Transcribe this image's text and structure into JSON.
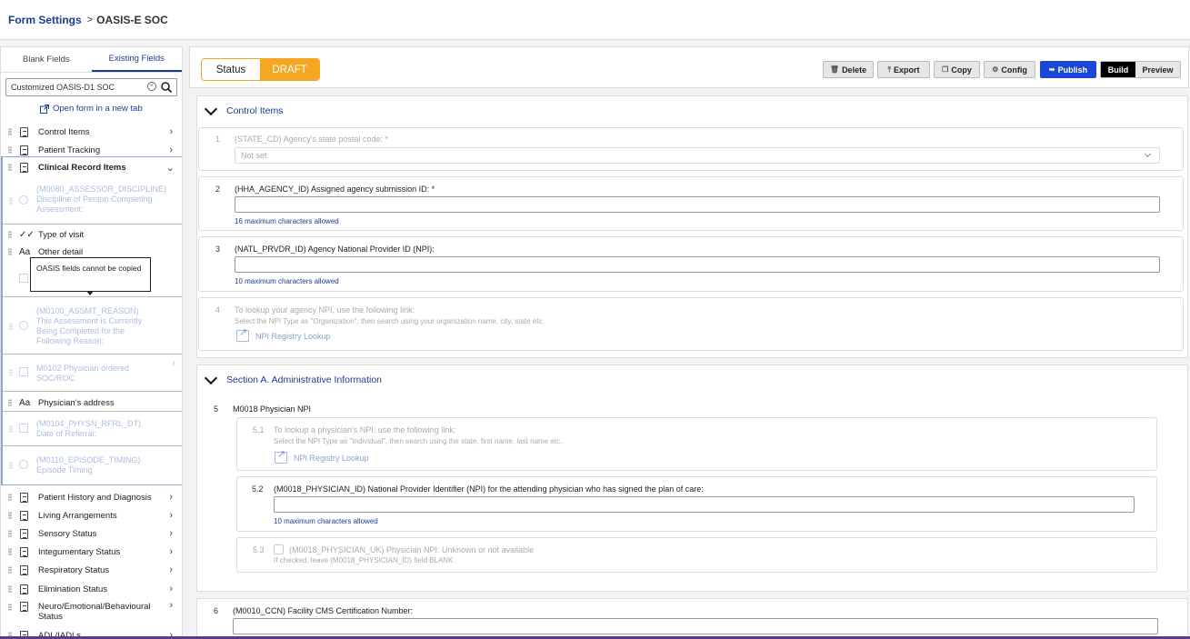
{
  "breadcrumb": {
    "parent": "Form Settings",
    "separator": ">",
    "current": "OASIS-E SOC"
  },
  "sidebar": {
    "tabs": [
      "Blank Fields",
      "Existing Fields"
    ],
    "search_value": "Customized OASIS-D1 SOC",
    "open_tab_label": "Open form in a new tab",
    "items_top": [
      "Control Items",
      "Patient Tracking",
      "Clinical Record Items"
    ],
    "sub_items": {
      "m0080": [
        "(M0080_ASSESSOR_DISCIPLINE)",
        "Discipline of Person Completing",
        "Assessment:"
      ],
      "type_of_visit": "Type of visit",
      "other_detail": "Other detail",
      "m0100": [
        "(M0100_ASSMT_REASON)",
        "This Assessment is Currently",
        "Being Completed for the",
        "Following Reason:"
      ],
      "m0102": [
        "M0102 Physician ordered",
        "SOC/ROC"
      ],
      "physician_address": "Physician's address",
      "m0104": [
        "(M0104_PHYSN_RFRL_DT)",
        "Date of Referral:"
      ],
      "m0110": [
        "(M0110_EPISODE_TIMING)",
        "Episode Timing"
      ]
    },
    "items_bottom": [
      "Patient History and Diagnosis",
      "Living Arrangements",
      "Sensory Status",
      "Integumentary Status",
      "Respiratory Status",
      "Elimination Status",
      "Neuro/Emotional/Behavioural Status",
      "ADL/IADLs"
    ],
    "tooltip": "OASIS fields cannot be copied"
  },
  "toolbar": {
    "status_label": "Status",
    "status_value": "DRAFT",
    "buttons": [
      "Delete",
      "Export",
      "Copy",
      "Config",
      "Publish"
    ],
    "mode": [
      "Build",
      "Preview"
    ]
  },
  "sections": [
    {
      "title": "Control Items",
      "questions": [
        {
          "num": "1",
          "label": "(STATE_CD) Agency's state postal code: *",
          "select": "Not set"
        },
        {
          "num": "2",
          "label": "(HHA_AGENCY_ID) Assigned agency submission ID: *",
          "hint": "16 maximum characters allowed"
        },
        {
          "num": "3",
          "label": "(NATL_PRVDR_ID) Agency National Provider ID (NPI):",
          "hint": "10 maximum characters allowed"
        },
        {
          "num": "4",
          "label": "To lookup your agency NPI, use the following link:",
          "hint": "Select the NPI Type as \"Organization\", then search using your organization name, city, state etc.",
          "link": "NPI Registry Lookup"
        }
      ]
    },
    {
      "title": "Section A. Administrative Information",
      "q5": {
        "num": "5",
        "label": "M0018 Physician NPI"
      },
      "q5_1": {
        "num": "5.1",
        "label": "To lookup a physician's NPI, use the following link:",
        "hint": "Select the NPI Type as \"Individual\", then search using the state, first name, last name etc.",
        "link": "NPI Registry Lookup"
      },
      "q5_2": {
        "num": "5.2",
        "label": "(M0018_PHYSICIAN_ID) National Provider Identifier (NPI) for the attending physician who has signed the plan of care:",
        "hint": "10 maximum characters allowed"
      },
      "q5_3": {
        "num": "5.3",
        "label": "(M0018_PHYSICIAN_UK) Physician NPI: Unknown or not available",
        "hint": "If checked, leave (M0018_PHYSICIAN_ID) field BLANK"
      }
    },
    {
      "q6": {
        "num": "6",
        "label": "(M0010_CCN) Facility CMS Certification Number:"
      }
    }
  ]
}
